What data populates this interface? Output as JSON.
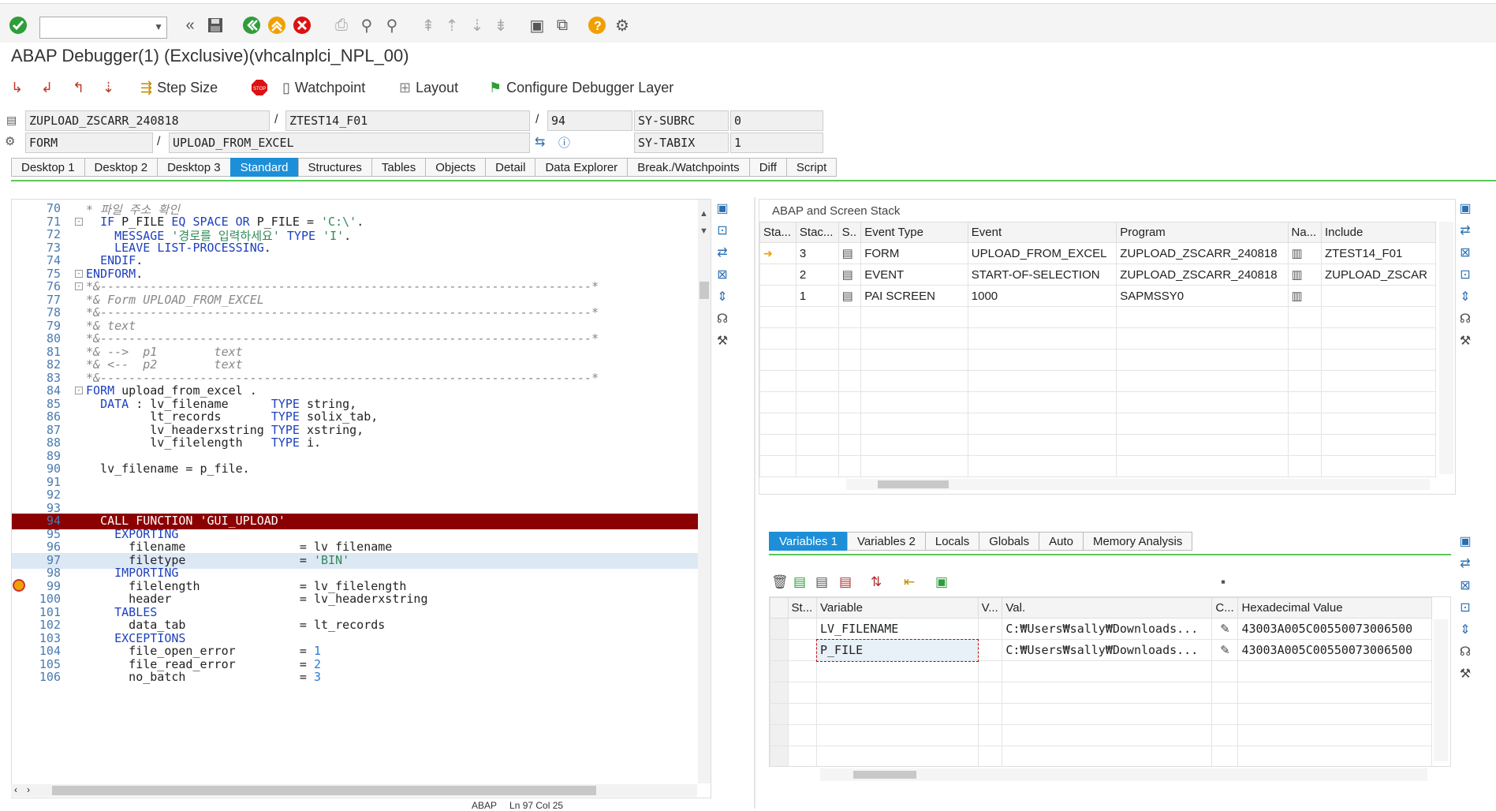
{
  "toolbar": {
    "command_field": "",
    "icons": [
      "enter-icon",
      "back-double-icon",
      "save-icon",
      "back-icon",
      "exit-icon",
      "cancel-icon",
      "print-icon",
      "find-icon",
      "find-next-icon",
      "first-page-icon",
      "prev-page-icon",
      "next-page-icon",
      "last-page-icon",
      "new-session-icon",
      "shortcut-icon",
      "help-icon",
      "settings-icon"
    ]
  },
  "window_title": "ABAP Debugger(1)  (Exclusive)(vhcalnplci_NPL_00)",
  "debug_toolbar": {
    "step_size": "Step Size",
    "watchpoint": "Watchpoint",
    "layout": "Layout",
    "configure": "Configure Debugger Layer"
  },
  "info": {
    "program": "ZUPLOAD_ZSCARR_240818",
    "include": "ZTEST14_F01",
    "line": "94",
    "sy_subrc_label": "SY-SUBRC",
    "sy_subrc_value": "0",
    "block_type": "FORM",
    "block_name": "UPLOAD_FROM_EXCEL",
    "sy_tabix_label": "SY-TABIX",
    "sy_tabix_value": "1",
    "slash": "/"
  },
  "tabs": [
    "Desktop 1",
    "Desktop 2",
    "Desktop 3",
    "Standard",
    "Structures",
    "Tables",
    "Objects",
    "Detail",
    "Data Explorer",
    "Break./Watchpoints",
    "Diff",
    "Script"
  ],
  "active_tab": "Standard",
  "code": [
    {
      "n": "70",
      "t": "* 파일 주소 확인",
      "c": "cm"
    },
    {
      "n": "71",
      "t": "  IF P_FILE EQ SPACE OR P_FILE = 'C:\\'.",
      "c": ""
    },
    {
      "n": "72",
      "t": "    MESSAGE '경로를 입력하세요' TYPE 'I'.",
      "c": ""
    },
    {
      "n": "73",
      "t": "    LEAVE LIST-PROCESSING.",
      "c": ""
    },
    {
      "n": "74",
      "t": "  ENDIF.",
      "c": ""
    },
    {
      "n": "75",
      "t": "ENDFORM.",
      "c": ""
    },
    {
      "n": "76",
      "t": "*&---------------------------------------------------------------------*",
      "c": "cm"
    },
    {
      "n": "77",
      "t": "*& Form UPLOAD_FROM_EXCEL",
      "c": "cm"
    },
    {
      "n": "78",
      "t": "*&---------------------------------------------------------------------*",
      "c": "cm"
    },
    {
      "n": "79",
      "t": "*& text",
      "c": "cm"
    },
    {
      "n": "80",
      "t": "*&---------------------------------------------------------------------*",
      "c": "cm"
    },
    {
      "n": "81",
      "t": "*& -->  p1        text",
      "c": "cm"
    },
    {
      "n": "82",
      "t": "*& <--  p2        text",
      "c": "cm"
    },
    {
      "n": "83",
      "t": "*&---------------------------------------------------------------------*",
      "c": "cm"
    },
    {
      "n": "84",
      "t": "FORM upload_from_excel .",
      "c": ""
    },
    {
      "n": "85",
      "t": "  DATA : lv_filename      TYPE string,",
      "c": ""
    },
    {
      "n": "86",
      "t": "         lt_records       TYPE solix_tab,",
      "c": ""
    },
    {
      "n": "87",
      "t": "         lv_headerxstring TYPE xstring,",
      "c": ""
    },
    {
      "n": "88",
      "t": "         lv_filelength    TYPE i.",
      "c": ""
    },
    {
      "n": "89",
      "t": "",
      "c": ""
    },
    {
      "n": "90",
      "t": "  lv_filename = p_file.",
      "c": ""
    },
    {
      "n": "91",
      "t": "",
      "c": ""
    },
    {
      "n": "92",
      "t": "",
      "c": ""
    },
    {
      "n": "93",
      "t": "",
      "c": ""
    },
    {
      "n": "94",
      "t": "  CALL FUNCTION 'GUI_UPLOAD'",
      "c": "red"
    },
    {
      "n": "95",
      "t": "    EXPORTING",
      "c": ""
    },
    {
      "n": "96",
      "t": "      filename                = lv_filename",
      "c": ""
    },
    {
      "n": "97",
      "t": "      filetype                = 'BIN'",
      "c": "blue"
    },
    {
      "n": "98",
      "t": "    IMPORTING",
      "c": ""
    },
    {
      "n": "99",
      "t": "      filelength              = lv_filelength",
      "c": ""
    },
    {
      "n": "100",
      "t": "      header                  = lv_headerxstring",
      "c": ""
    },
    {
      "n": "101",
      "t": "    TABLES",
      "c": ""
    },
    {
      "n": "102",
      "t": "      data_tab                = lt_records",
      "c": ""
    },
    {
      "n": "103",
      "t": "    EXCEPTIONS",
      "c": ""
    },
    {
      "n": "104",
      "t": "      file_open_error         = 1",
      "c": ""
    },
    {
      "n": "105",
      "t": "      file_read_error         = 2",
      "c": ""
    },
    {
      "n": "106",
      "t": "      no_batch                = 3",
      "c": ""
    }
  ],
  "stack": {
    "title": "ABAP and Screen Stack",
    "headers": [
      "Sta...",
      "Stac...",
      "S..",
      "Event Type",
      "Event",
      "Program",
      "Na...",
      "Include"
    ],
    "rows": [
      {
        "level": "3",
        "type": "FORM",
        "event": "UPLOAD_FROM_EXCEL",
        "program": "ZUPLOAD_ZSCARR_240818",
        "include": "ZTEST14_F01"
      },
      {
        "level": "2",
        "type": "EVENT",
        "event": "START-OF-SELECTION",
        "program": "ZUPLOAD_ZSCARR_240818",
        "include": "ZUPLOAD_ZSCAR"
      },
      {
        "level": "1",
        "type": "PAI SCREEN",
        "event": "1000",
        "program": "SAPMSSY0",
        "include": ""
      }
    ]
  },
  "var_tabs": [
    "Variables 1",
    "Variables 2",
    "Locals",
    "Globals",
    "Auto",
    "Memory Analysis"
  ],
  "active_var_tab": "Variables 1",
  "variables": {
    "headers": [
      "St...",
      "Variable",
      "V...",
      "Val.",
      "C...",
      "Hexadecimal Value"
    ],
    "rows": [
      {
        "name": "LV_FILENAME",
        "value": "C:₩Users₩sally₩Downloads...",
        "hex": "43003A005C00550073006500"
      },
      {
        "name": "P_FILE",
        "value": "C:₩Users₩sally₩Downloads...",
        "hex": "43003A005C00550073006500"
      }
    ]
  },
  "status_bar": {
    "lang": "ABAP",
    "pos": "Ln 97 Col 25"
  }
}
